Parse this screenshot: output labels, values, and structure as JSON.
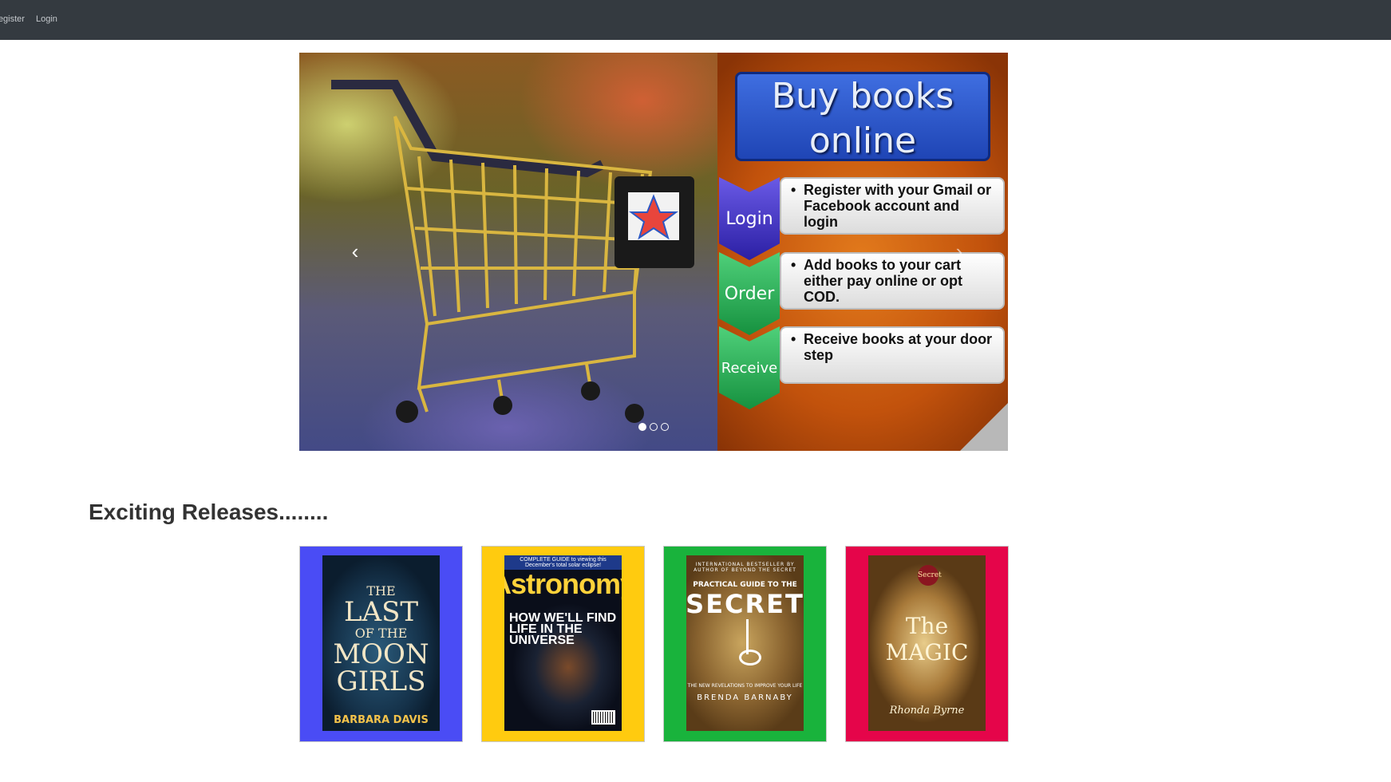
{
  "nav": {
    "register": "Register",
    "login": "Login"
  },
  "carousel": {
    "slide": {
      "banner_line1": "Buy books",
      "banner_line2": "online",
      "steps": [
        {
          "badge": "Login",
          "text": "Register with your Gmail or Facebook account and login"
        },
        {
          "badge": "Order",
          "text": "Add books to your cart either pay online or opt COD."
        },
        {
          "badge": "Receive",
          "text": "Receive books at your door step"
        }
      ]
    },
    "prev": "‹",
    "next": "›",
    "indicator_count": 3,
    "active_index": 0
  },
  "section": {
    "title": "Exciting Releases........"
  },
  "books": [
    {
      "card_color": "#4a4cf5",
      "cover": {
        "pre": "THE",
        "big1": "LAST",
        "mid": "OF THE",
        "big2": "MOON GIRLS",
        "author": "BARBARA DAVIS"
      }
    },
    {
      "card_color": "#ffcb0f",
      "cover": {
        "top": "COMPLETE GUIDE to viewing this December's total solar eclipse!",
        "mast": "Astronomy",
        "sub": "HOW WE'LL FIND LIFE IN THE UNIVERSE"
      }
    },
    {
      "card_color": "#19b33c",
      "cover": {
        "intl": "INTERNATIONAL BESTSELLER BY AUTHOR OF BEYOND THE SECRET",
        "guide": "PRACTICAL GUIDE TO THE",
        "title": "SECRET",
        "rev": "THE NEW REVELATIONS TO IMPROVE YOUR LIFE",
        "author": "BRENDA BARNABY"
      }
    },
    {
      "card_color": "#e5054a",
      "cover": {
        "seal": "Secret",
        "title": "The MAGIC",
        "author": "Rhonda Byrne"
      }
    }
  ]
}
